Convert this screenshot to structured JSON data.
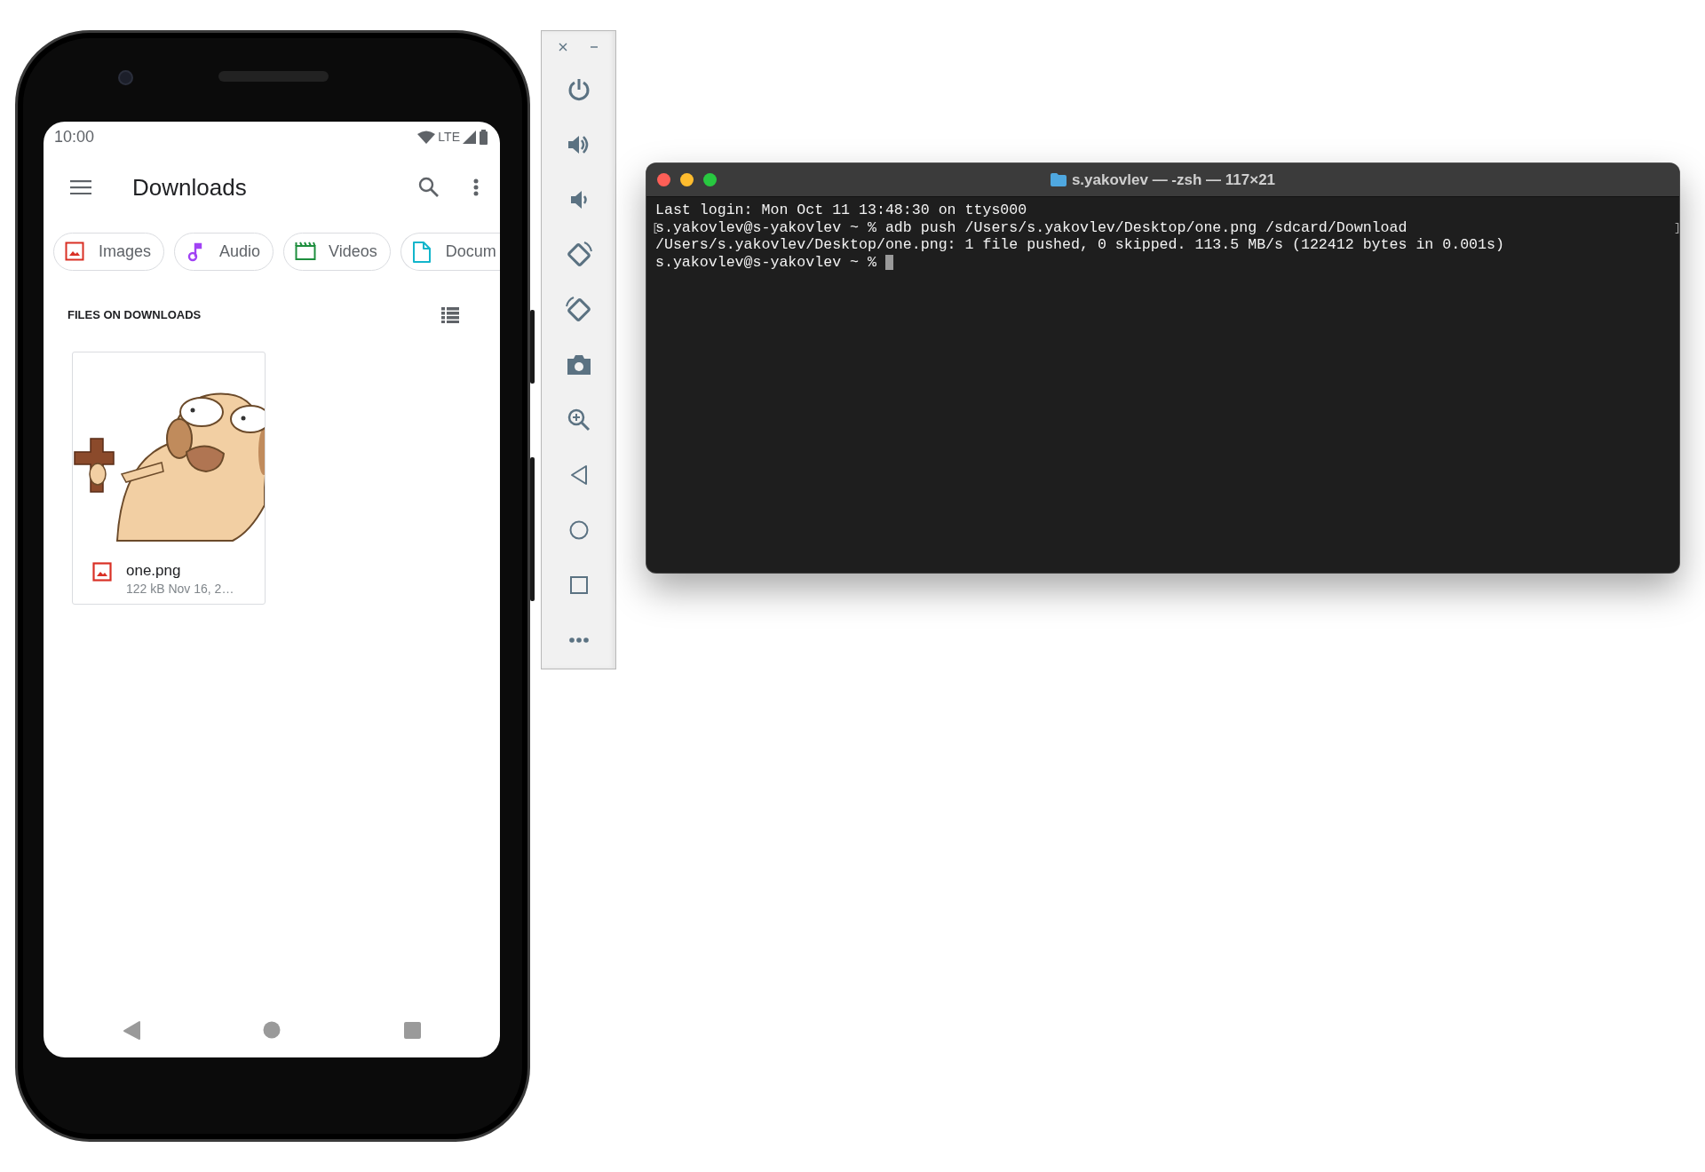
{
  "phone": {
    "status_bar": {
      "time": "10:00",
      "network": "LTE"
    },
    "app_bar": {
      "title": "Downloads"
    },
    "chips": [
      {
        "label": "Images",
        "kind": "image",
        "color": "#d93025"
      },
      {
        "label": "Audio",
        "kind": "audio",
        "color": "#a142f4"
      },
      {
        "label": "Videos",
        "kind": "video",
        "color": "#1e8e3e"
      },
      {
        "label": "Docum",
        "kind": "document",
        "color": "#12b5cb"
      }
    ],
    "section": {
      "heading": "FILES ON DOWNLOADS"
    },
    "files": [
      {
        "name": "one.png",
        "meta": "122 kB Nov 16, 2…"
      }
    ]
  },
  "terminal": {
    "title": "s.yakovlev — -zsh — 117×21",
    "lines": [
      {
        "text": "Last login: Mon Oct 11 13:48:30 on ttys000",
        "cursor": false
      },
      {
        "text": "s.yakovlev@s-yakovlev ~ % adb push /Users/s.yakovlev/Desktop/one.png /sdcard/Download",
        "bracket_open": "[",
        "bracket_close": "]",
        "cursor": false
      },
      {
        "text": "/Users/s.yakovlev/Desktop/one.png: 1 file pushed, 0 skipped. 113.5 MB/s (122412 bytes in 0.001s)",
        "cursor": false
      },
      {
        "text": "s.yakovlev@s-yakovlev ~ % ",
        "cursor": true
      }
    ]
  }
}
